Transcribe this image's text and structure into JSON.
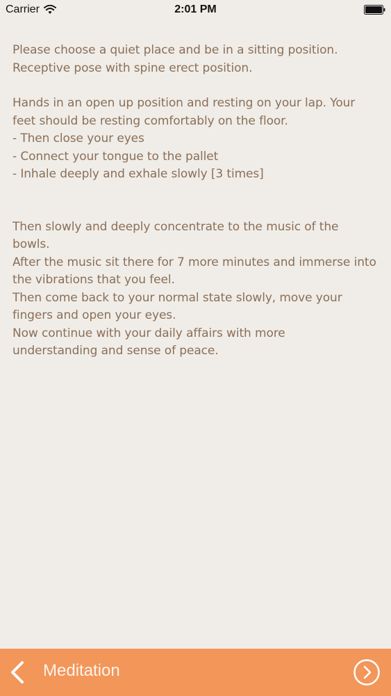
{
  "status_bar": {
    "carrier": "Carrier",
    "time": "2:01 PM",
    "icons": [
      "wifi-icon",
      "battery-icon"
    ]
  },
  "content": {
    "p1_line1": "Please choose a quiet place and be in a sitting position.",
    "p1_line2": "Receptive pose with spine erect position.",
    "p2_line1": "Hands in an open up position and resting on your lap. Your",
    "p2_line2": "feet should be resting comfortably on the floor.",
    "p2_line3": "- Then close your eyes",
    "p2_line4": "- Connect your tongue to the pallet",
    "p2_line5": "- Inhale deeply and exhale slowly [3 times]",
    "p3_line1": "Then slowly and deeply concentrate to the music of the",
    "p3_line2": "bowls.",
    "p3_line3": "After the music sit there for 7 more minutes and immerse into",
    "p3_line4": "the vibrations that you feel.",
    "p3_line5": "Then come back to your normal state slowly, move your",
    "p3_line6": "fingers and open your eyes.",
    "p3_line7": "Now continue with your daily affairs with more",
    "p3_line8": "understanding and sense of peace."
  },
  "bottom_bar": {
    "title": "Meditation",
    "back_icon": "chevron-left-icon",
    "next_icon": "chevron-right-circle-icon",
    "color": "#f2965a"
  }
}
